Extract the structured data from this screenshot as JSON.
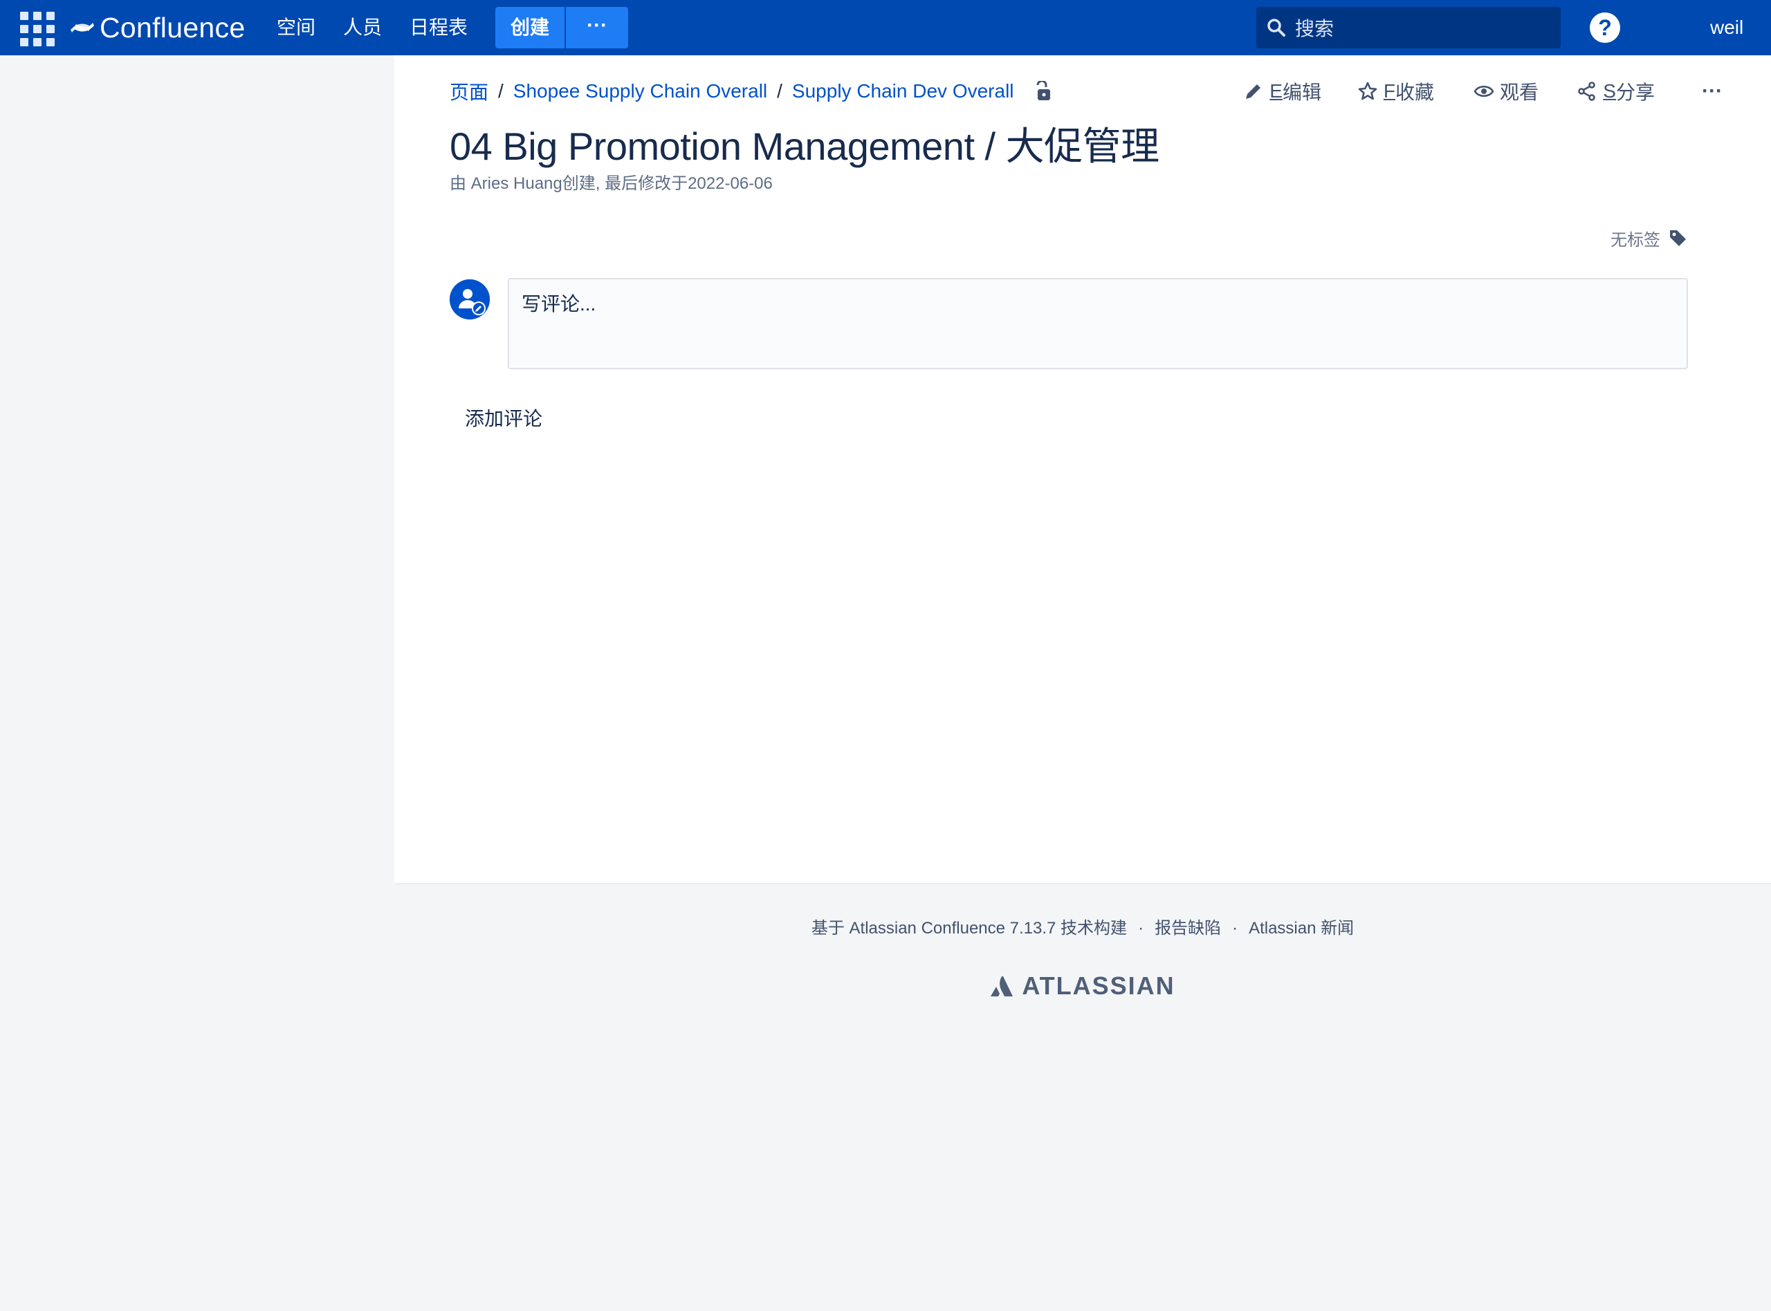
{
  "topbar": {
    "app_name": "Confluence",
    "nav": [
      "空间",
      "人员",
      "日程表"
    ],
    "create_label": "创建",
    "more_label": "···",
    "search_placeholder": "搜索",
    "help_label": "?",
    "user_name": "weil"
  },
  "breadcrumb": {
    "items": [
      "页面",
      "Shopee Supply Chain Overall",
      "Supply Chain Dev Overall"
    ],
    "separator": "/"
  },
  "actions": {
    "edit": {
      "key": "E",
      "label": "编辑"
    },
    "favorite": {
      "key": "F",
      "label": "收藏"
    },
    "watch": {
      "label": "观看"
    },
    "share": {
      "key": "S",
      "label": "分享"
    },
    "more": "···"
  },
  "page": {
    "title": "04 Big Promotion Management / 大促管理",
    "meta_prefix": "由 ",
    "author": "Aries Huang",
    "meta_suffix": "创建, 最后修改于2022-06-06",
    "no_labels": "无标签"
  },
  "comment": {
    "placeholder": "写评论...",
    "add_comment": "添加评论"
  },
  "footer": {
    "powered_by": "基于 Atlassian Confluence 7.13.7 技术构建",
    "report_bug": "报告缺陷",
    "news": "Atlassian 新闻",
    "dot": "·",
    "brand": "ATLASSIAN"
  },
  "colors": {
    "topbar": "#0049b0",
    "create_button": "#1e7cf5",
    "link": "#0052cc",
    "text": "#172b4d",
    "page_background": "#f4f5f7"
  },
  "icons": [
    "app-switcher-icon",
    "confluence-logo-icon",
    "search-icon",
    "help-icon",
    "lock-icon",
    "pencil-icon",
    "star-icon",
    "eye-icon",
    "share-icon",
    "tag-icon",
    "avatar-icon",
    "atlassian-logo-icon"
  ]
}
